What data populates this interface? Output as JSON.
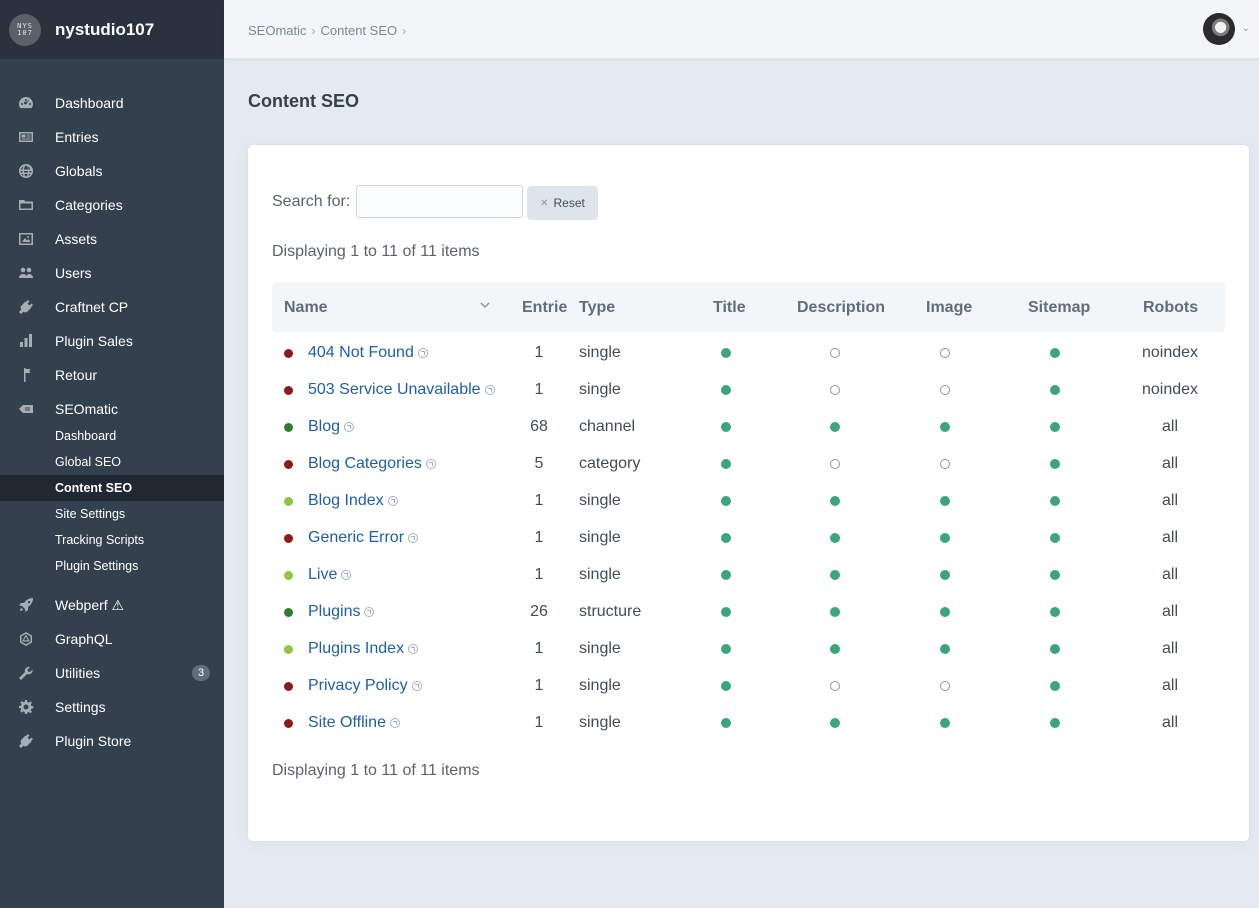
{
  "site": {
    "name": "nystudio107",
    "logo_text": "NYS\n107"
  },
  "colors": {
    "status_red": "#8b1a1a",
    "status_darkgreen": "#2e7d2e",
    "status_lightgreen": "#8dc63f",
    "on": "#3aa67a"
  },
  "nav": {
    "items": [
      {
        "label": "Dashboard",
        "icon": "gauge-icon"
      },
      {
        "label": "Entries",
        "icon": "entries-icon"
      },
      {
        "label": "Globals",
        "icon": "globe-icon"
      },
      {
        "label": "Categories",
        "icon": "folder-icon"
      },
      {
        "label": "Assets",
        "icon": "image-icon"
      },
      {
        "label": "Users",
        "icon": "users-icon"
      },
      {
        "label": "Craftnet CP",
        "icon": "plug-icon"
      },
      {
        "label": "Plugin Sales",
        "icon": "bar-chart-icon"
      },
      {
        "label": "Retour",
        "icon": "signpost-icon"
      },
      {
        "label": "SEOmatic",
        "icon": "tag-icon"
      }
    ],
    "seomatic_sub": [
      {
        "label": "Dashboard"
      },
      {
        "label": "Global SEO"
      },
      {
        "label": "Content SEO"
      },
      {
        "label": "Site Settings"
      },
      {
        "label": "Tracking Scripts"
      },
      {
        "label": "Plugin Settings"
      }
    ],
    "items_after": [
      {
        "label": "Webperf ⚠",
        "icon": "rocket-icon"
      },
      {
        "label": "GraphQL",
        "icon": "graphql-icon"
      },
      {
        "label": "Utilities",
        "icon": "wrench-icon",
        "badge": "3"
      },
      {
        "label": "Settings",
        "icon": "gear-icon"
      },
      {
        "label": "Plugin Store",
        "icon": "plug-store-icon"
      }
    ]
  },
  "breadcrumb": [
    "SEOmatic",
    "Content SEO"
  ],
  "page_title": "Content SEO",
  "search": {
    "label": "Search for:",
    "value": "",
    "placeholder": "",
    "reset_label": "Reset"
  },
  "display_count": "Displaying 1 to 11 of 11 items",
  "table": {
    "headers": {
      "name": "Name",
      "entries": "Entrie",
      "type": "Type",
      "title": "Title",
      "description": "Description",
      "image": "Image",
      "sitemap": "Sitemap",
      "robots": "Robots"
    },
    "rows": [
      {
        "status": "red",
        "name": "404 Not Found",
        "entries": "1",
        "type": "single",
        "title": true,
        "description": false,
        "image": false,
        "sitemap": true,
        "robots": "noindex"
      },
      {
        "status": "red",
        "name": "503 Service Unavailable",
        "entries": "1",
        "type": "single",
        "title": true,
        "description": false,
        "image": false,
        "sitemap": true,
        "robots": "noindex"
      },
      {
        "status": "darkgreen",
        "name": "Blog",
        "entries": "68",
        "type": "channel",
        "title": true,
        "description": true,
        "image": true,
        "sitemap": true,
        "robots": "all"
      },
      {
        "status": "red",
        "name": "Blog Categories",
        "entries": "5",
        "type": "category",
        "title": true,
        "description": false,
        "image": false,
        "sitemap": true,
        "robots": "all"
      },
      {
        "status": "lightgreen",
        "name": "Blog Index",
        "entries": "1",
        "type": "single",
        "title": true,
        "description": true,
        "image": true,
        "sitemap": true,
        "robots": "all"
      },
      {
        "status": "red",
        "name": "Generic Error",
        "entries": "1",
        "type": "single",
        "title": true,
        "description": true,
        "image": true,
        "sitemap": true,
        "robots": "all"
      },
      {
        "status": "lightgreen",
        "name": "Live",
        "entries": "1",
        "type": "single",
        "title": true,
        "description": true,
        "image": true,
        "sitemap": true,
        "robots": "all"
      },
      {
        "status": "darkgreen",
        "name": "Plugins",
        "entries": "26",
        "type": "structure",
        "title": true,
        "description": true,
        "image": true,
        "sitemap": true,
        "robots": "all"
      },
      {
        "status": "lightgreen",
        "name": "Plugins Index",
        "entries": "1",
        "type": "single",
        "title": true,
        "description": true,
        "image": true,
        "sitemap": true,
        "robots": "all"
      },
      {
        "status": "red",
        "name": "Privacy Policy",
        "entries": "1",
        "type": "single",
        "title": true,
        "description": false,
        "image": false,
        "sitemap": true,
        "robots": "all"
      },
      {
        "status": "red",
        "name": "Site Offline",
        "entries": "1",
        "type": "single",
        "title": true,
        "description": true,
        "image": true,
        "sitemap": true,
        "robots": "all"
      }
    ]
  }
}
